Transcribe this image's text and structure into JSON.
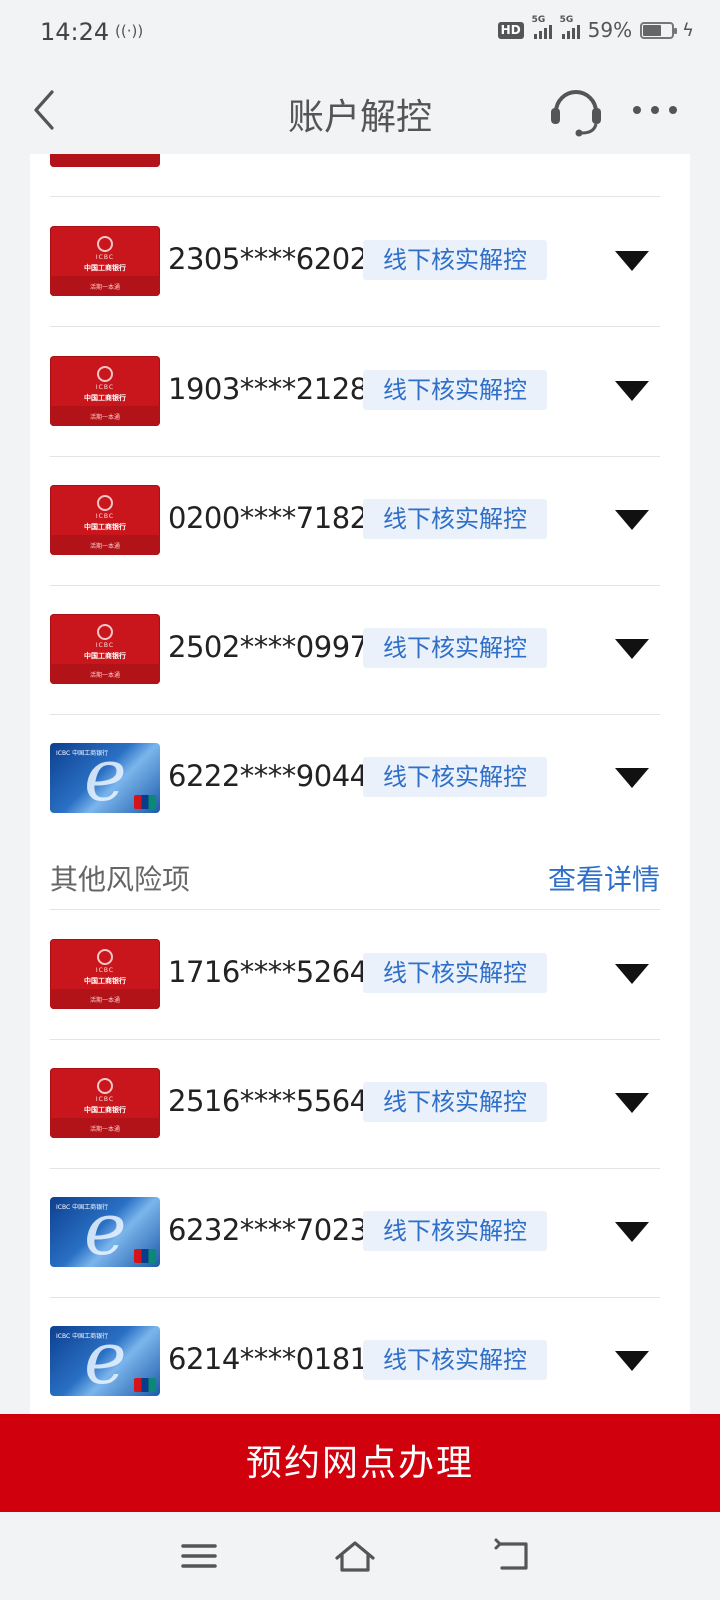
{
  "status_bar": {
    "time": "14:24",
    "nfc": "((·))",
    "hd": "HD",
    "signal1_label": "5G",
    "signal2_label": "5G",
    "battery": "59%"
  },
  "nav": {
    "title": "账户解控"
  },
  "accounts_top": [
    {
      "number": "2305****6202",
      "status": "线下核实解控",
      "card_style": "red"
    },
    {
      "number": "1903****2128",
      "status": "线下核实解控",
      "card_style": "red"
    },
    {
      "number": "0200****7182",
      "status": "线下核实解控",
      "card_style": "red"
    },
    {
      "number": "2502****0997",
      "status": "线下核实解控",
      "card_style": "red"
    },
    {
      "number": "6222****9044",
      "status": "线下核实解控",
      "card_style": "blue"
    }
  ],
  "other_risks": {
    "title": "其他风险项",
    "link": "查看详情"
  },
  "accounts_other": [
    {
      "number": "1716****5264",
      "status": "线下核实解控",
      "card_style": "red"
    },
    {
      "number": "2516****5564",
      "status": "线下核实解控",
      "card_style": "red"
    },
    {
      "number": "6232****7023",
      "status": "线下核实解控",
      "card_style": "blue"
    },
    {
      "number": "6214****0181",
      "status": "线下核实解控",
      "card_style": "blue"
    }
  ],
  "red_card": {
    "brand": "ICBC",
    "bank_name": "中国工商银行",
    "series": "活期一本通"
  },
  "blue_card": {
    "topline": "ICBC 中国工商银行"
  },
  "action": {
    "label": "预约网点办理"
  },
  "colors": {
    "accent_red": "#d0000c",
    "link_blue": "#2f6fc7",
    "tag_bg": "#eaf1fb"
  }
}
